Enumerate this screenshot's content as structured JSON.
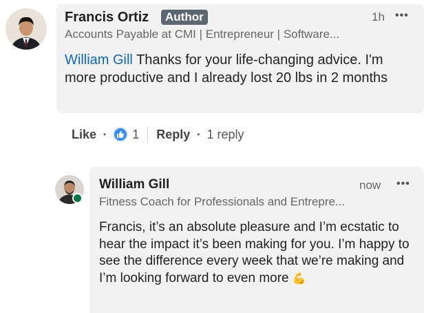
{
  "comment": {
    "author_name": "Francis Ortiz",
    "badge": "Author",
    "headline": "Accounts Payable at CMI | Entrepreneur | Software...",
    "time": "1h",
    "more": "•••",
    "mention": "William Gill",
    "text": "Thanks for your life-changing advice. I'm more productive and I already lost 20 lbs in 2 months",
    "actions": {
      "like": "Like",
      "reaction_count": "1",
      "reply": "Reply",
      "reply_count": "1 reply"
    }
  },
  "reply": {
    "author_name": "William Gill",
    "headline": "Fitness Coach for Professionals and Entrepre...",
    "time": "now",
    "more": "•••",
    "text": "Francis, it’s an absolute pleasure and I’m ecstatic to hear the impact it’s been making for you. I’m happy to see the difference every week that we’re making and I’m looking forward to even more",
    "emoji": "💪"
  },
  "icons": {
    "reaction": "like-thumb-icon",
    "online": "online-status-icon"
  },
  "colors": {
    "mention": "#0a66c2",
    "reaction": "#378fe9",
    "online": "#057642",
    "bubble": "#f2f2f2"
  }
}
